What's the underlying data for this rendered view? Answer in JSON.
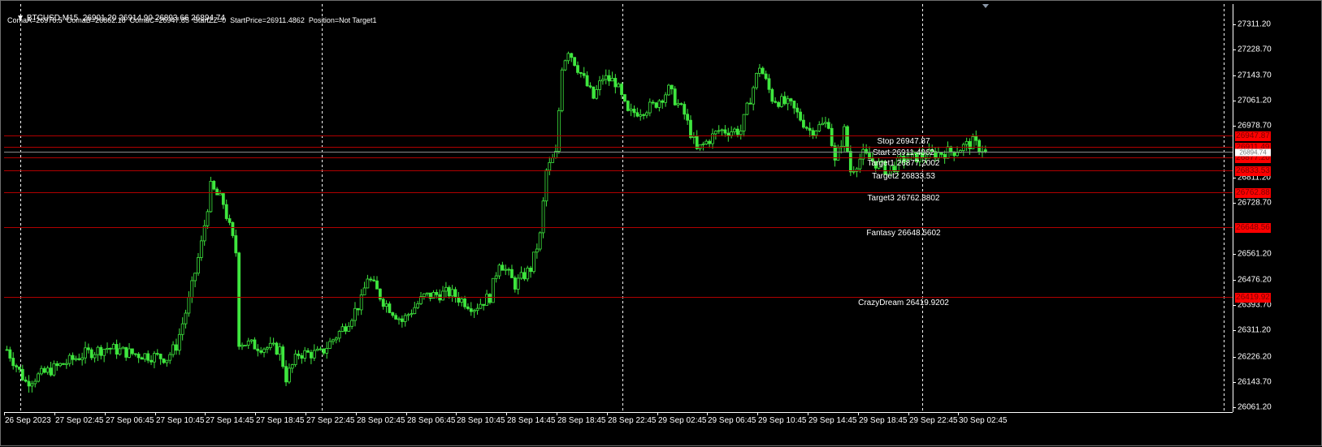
{
  "header": {
    "symbol_line": "BTCUSD,M15  26901.20 26914.90 26893.66 26894.74",
    "indicator_line": "ComaA=26976.5  ComaB=26862.18  ComaC=26947.85  StartZZ=0  StartPrice=26911.4862  Position=Not Target1"
  },
  "colors": {
    "bull": "#3ee63e",
    "level_line": "#b00000",
    "level_box": "#ff0000",
    "grid": "#ffffff",
    "background": "#000000"
  },
  "chart_data": {
    "type": "candlestick",
    "symbol": "BTCUSD",
    "timeframe": "M15",
    "ohlc_last": {
      "open": 26901.2,
      "high": 26914.9,
      "low": 26893.66,
      "close": 26894.74
    },
    "price_axis": {
      "ylim": [
        26045,
        27377
      ],
      "ticks": [
        "27311.20",
        "27228.70",
        "27143.70",
        "27061.20",
        "26978.70",
        "26811.20",
        "26728.70",
        "26561.20",
        "26476.20",
        "26393.70",
        "26311.20",
        "26226.20",
        "26143.70",
        "26061.20"
      ],
      "tick_values": [
        27311.2,
        27228.7,
        27143.7,
        27061.2,
        26978.7,
        26811.2,
        26728.7,
        26561.2,
        26476.2,
        26393.7,
        26311.2,
        26226.2,
        26143.7,
        26061.2
      ]
    },
    "time_axis": {
      "bars_per_label": 16,
      "ticks": [
        "26 Sep 2023",
        "27 Sep 02:45",
        "27 Sep 06:45",
        "27 Sep 10:45",
        "27 Sep 14:45",
        "27 Sep 18:45",
        "27 Sep 22:45",
        "28 Sep 02:45",
        "28 Sep 06:45",
        "28 Sep 10:45",
        "28 Sep 14:45",
        "28 Sep 18:45",
        "28 Sep 22:45",
        "29 Sep 02:45",
        "29 Sep 06:45",
        "29 Sep 10:45",
        "29 Sep 14:45",
        "29 Sep 18:45",
        "29 Sep 22:45",
        "30 Sep 02:45"
      ]
    },
    "close_waypoints": [
      [
        0,
        26249
      ],
      [
        6,
        26143
      ],
      [
        14,
        26183
      ],
      [
        25,
        26236
      ],
      [
        32,
        26255
      ],
      [
        40,
        26236
      ],
      [
        51,
        26222
      ],
      [
        54,
        26262
      ],
      [
        58,
        26408
      ],
      [
        62,
        26594
      ],
      [
        65,
        26779
      ],
      [
        69,
        26727
      ],
      [
        73,
        26568
      ],
      [
        74,
        26276
      ],
      [
        79,
        26262
      ],
      [
        87,
        26249
      ],
      [
        89,
        26157
      ],
      [
        93,
        26236
      ],
      [
        100,
        26236
      ],
      [
        108,
        26329
      ],
      [
        113,
        26408
      ],
      [
        115,
        26487
      ],
      [
        120,
        26408
      ],
      [
        126,
        26342
      ],
      [
        133,
        26422
      ],
      [
        141,
        26435
      ],
      [
        149,
        26387
      ],
      [
        154,
        26422
      ],
      [
        157,
        26540
      ],
      [
        162,
        26461
      ],
      [
        167,
        26514
      ],
      [
        170,
        26620
      ],
      [
        172,
        26832
      ],
      [
        175,
        26885
      ],
      [
        177,
        27176
      ],
      [
        179,
        27229
      ],
      [
        183,
        27150
      ],
      [
        187,
        27070
      ],
      [
        190,
        27137
      ],
      [
        194,
        27123
      ],
      [
        198,
        27017
      ],
      [
        206,
        27044
      ],
      [
        211,
        27097
      ],
      [
        216,
        27017
      ],
      [
        220,
        26898
      ],
      [
        227,
        26964
      ],
      [
        234,
        26964
      ],
      [
        240,
        27176
      ],
      [
        244,
        27070
      ],
      [
        250,
        27044
      ],
      [
        256,
        26964
      ],
      [
        262,
        26990
      ],
      [
        264,
        26858
      ],
      [
        267,
        26964
      ],
      [
        269,
        26832
      ],
      [
        273,
        26885
      ],
      [
        281,
        26832
      ],
      [
        286,
        26872
      ],
      [
        294,
        26885
      ],
      [
        302,
        26898
      ],
      [
        308,
        26925
      ],
      [
        312,
        26894.74
      ]
    ],
    "current_price": {
      "value": 26894.74,
      "label": "26894.74"
    },
    "levels": [
      {
        "name": "Stop",
        "value": 26947.87,
        "text": "Stop 26947.87",
        "axis_label": "26947.87"
      },
      {
        "name": "Start",
        "value": 26911.49,
        "text": "Start 26911.4862",
        "axis_label": "26911.49"
      },
      {
        "name": "Target1",
        "value": 26877.2,
        "text": "Target1 26877.2002",
        "axis_label": "26877.20"
      },
      {
        "name": "Target2",
        "value": 26833.53,
        "text": "Target2 26833.53",
        "axis_label": "26833.53"
      },
      {
        "name": "Target3",
        "value": 26762.88,
        "text": "Target3 26762.8802",
        "axis_label": "26762.88"
      },
      {
        "name": "Fantasy",
        "value": 26648.56,
        "text": "Fantasy 26648.5602",
        "axis_label": "26648.56"
      },
      {
        "name": "CrazyDream",
        "value": 26419.92,
        "text": "CrazyDream 26419.9202",
        "axis_label": "26419.92"
      }
    ]
  }
}
